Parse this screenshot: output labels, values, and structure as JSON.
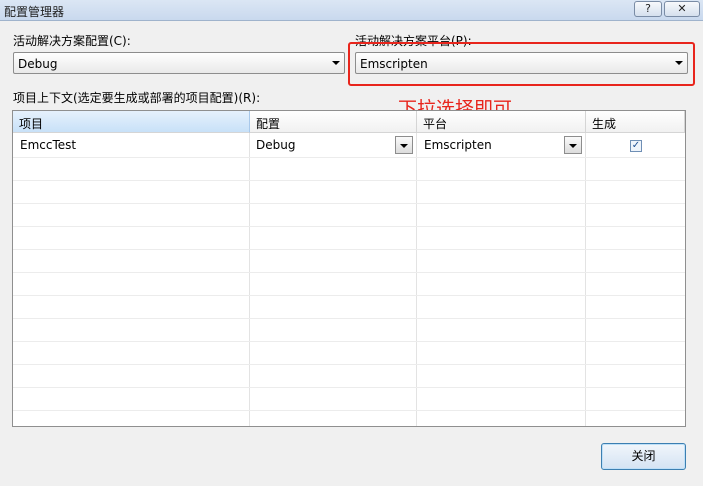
{
  "window": {
    "title": "配置管理器",
    "help_label": "?",
    "close_label": "✕"
  },
  "active_config": {
    "label": "活动解决方案配置(C):",
    "value": "Debug"
  },
  "active_platform": {
    "label": "活动解决方案平台(P):",
    "value": "Emscripten"
  },
  "annotation": {
    "text": "下拉选择即可",
    "color": "#e8251c"
  },
  "project_contexts": {
    "label": "项目上下文(选定要生成或部署的项目配置)(R):",
    "columns": [
      "项目",
      "配置",
      "平台",
      "生成"
    ],
    "rows": [
      {
        "project": "EmccTest",
        "config": "Debug",
        "platform": "Emscripten",
        "build": true
      }
    ]
  },
  "footer": {
    "close_button": "关闭"
  },
  "icons": {
    "dropdown": "chevron-down-icon",
    "check": "checkmark-icon"
  }
}
